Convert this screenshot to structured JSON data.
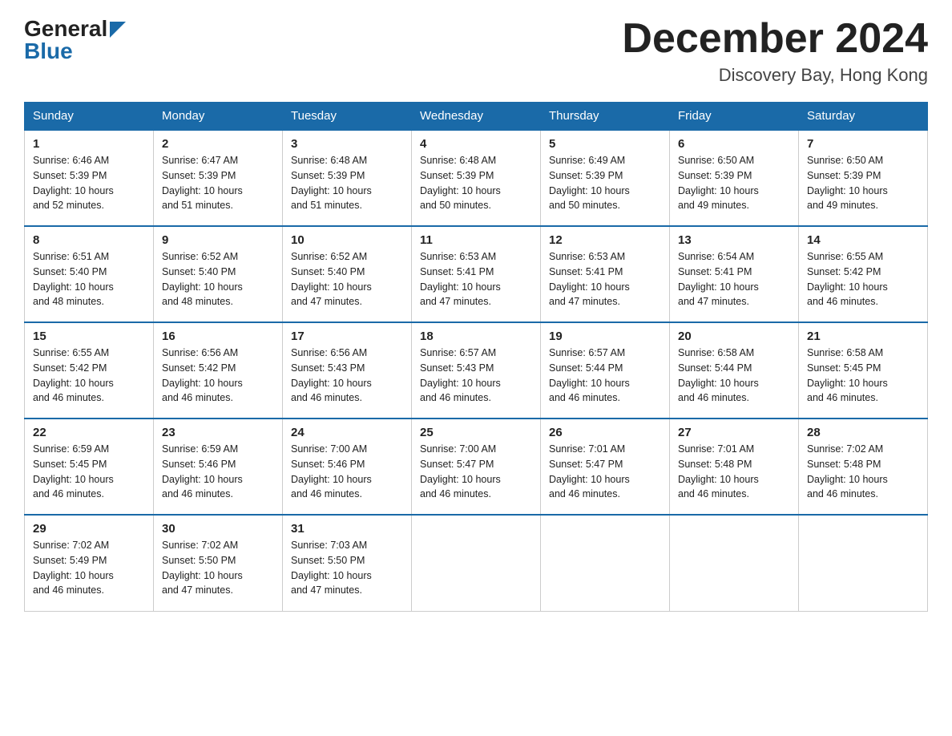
{
  "header": {
    "logo_general": "General",
    "logo_blue": "Blue",
    "title": "December 2024",
    "location": "Discovery Bay, Hong Kong"
  },
  "days_of_week": [
    "Sunday",
    "Monday",
    "Tuesday",
    "Wednesday",
    "Thursday",
    "Friday",
    "Saturday"
  ],
  "weeks": [
    [
      {
        "day": "1",
        "sunrise": "6:46 AM",
        "sunset": "5:39 PM",
        "daylight": "10 hours and 52 minutes."
      },
      {
        "day": "2",
        "sunrise": "6:47 AM",
        "sunset": "5:39 PM",
        "daylight": "10 hours and 51 minutes."
      },
      {
        "day": "3",
        "sunrise": "6:48 AM",
        "sunset": "5:39 PM",
        "daylight": "10 hours and 51 minutes."
      },
      {
        "day": "4",
        "sunrise": "6:48 AM",
        "sunset": "5:39 PM",
        "daylight": "10 hours and 50 minutes."
      },
      {
        "day": "5",
        "sunrise": "6:49 AM",
        "sunset": "5:39 PM",
        "daylight": "10 hours and 50 minutes."
      },
      {
        "day": "6",
        "sunrise": "6:50 AM",
        "sunset": "5:39 PM",
        "daylight": "10 hours and 49 minutes."
      },
      {
        "day": "7",
        "sunrise": "6:50 AM",
        "sunset": "5:39 PM",
        "daylight": "10 hours and 49 minutes."
      }
    ],
    [
      {
        "day": "8",
        "sunrise": "6:51 AM",
        "sunset": "5:40 PM",
        "daylight": "10 hours and 48 minutes."
      },
      {
        "day": "9",
        "sunrise": "6:52 AM",
        "sunset": "5:40 PM",
        "daylight": "10 hours and 48 minutes."
      },
      {
        "day": "10",
        "sunrise": "6:52 AM",
        "sunset": "5:40 PM",
        "daylight": "10 hours and 47 minutes."
      },
      {
        "day": "11",
        "sunrise": "6:53 AM",
        "sunset": "5:41 PM",
        "daylight": "10 hours and 47 minutes."
      },
      {
        "day": "12",
        "sunrise": "6:53 AM",
        "sunset": "5:41 PM",
        "daylight": "10 hours and 47 minutes."
      },
      {
        "day": "13",
        "sunrise": "6:54 AM",
        "sunset": "5:41 PM",
        "daylight": "10 hours and 47 minutes."
      },
      {
        "day": "14",
        "sunrise": "6:55 AM",
        "sunset": "5:42 PM",
        "daylight": "10 hours and 46 minutes."
      }
    ],
    [
      {
        "day": "15",
        "sunrise": "6:55 AM",
        "sunset": "5:42 PM",
        "daylight": "10 hours and 46 minutes."
      },
      {
        "day": "16",
        "sunrise": "6:56 AM",
        "sunset": "5:42 PM",
        "daylight": "10 hours and 46 minutes."
      },
      {
        "day": "17",
        "sunrise": "6:56 AM",
        "sunset": "5:43 PM",
        "daylight": "10 hours and 46 minutes."
      },
      {
        "day": "18",
        "sunrise": "6:57 AM",
        "sunset": "5:43 PM",
        "daylight": "10 hours and 46 minutes."
      },
      {
        "day": "19",
        "sunrise": "6:57 AM",
        "sunset": "5:44 PM",
        "daylight": "10 hours and 46 minutes."
      },
      {
        "day": "20",
        "sunrise": "6:58 AM",
        "sunset": "5:44 PM",
        "daylight": "10 hours and 46 minutes."
      },
      {
        "day": "21",
        "sunrise": "6:58 AM",
        "sunset": "5:45 PM",
        "daylight": "10 hours and 46 minutes."
      }
    ],
    [
      {
        "day": "22",
        "sunrise": "6:59 AM",
        "sunset": "5:45 PM",
        "daylight": "10 hours and 46 minutes."
      },
      {
        "day": "23",
        "sunrise": "6:59 AM",
        "sunset": "5:46 PM",
        "daylight": "10 hours and 46 minutes."
      },
      {
        "day": "24",
        "sunrise": "7:00 AM",
        "sunset": "5:46 PM",
        "daylight": "10 hours and 46 minutes."
      },
      {
        "day": "25",
        "sunrise": "7:00 AM",
        "sunset": "5:47 PM",
        "daylight": "10 hours and 46 minutes."
      },
      {
        "day": "26",
        "sunrise": "7:01 AM",
        "sunset": "5:47 PM",
        "daylight": "10 hours and 46 minutes."
      },
      {
        "day": "27",
        "sunrise": "7:01 AM",
        "sunset": "5:48 PM",
        "daylight": "10 hours and 46 minutes."
      },
      {
        "day": "28",
        "sunrise": "7:02 AM",
        "sunset": "5:48 PM",
        "daylight": "10 hours and 46 minutes."
      }
    ],
    [
      {
        "day": "29",
        "sunrise": "7:02 AM",
        "sunset": "5:49 PM",
        "daylight": "10 hours and 46 minutes."
      },
      {
        "day": "30",
        "sunrise": "7:02 AM",
        "sunset": "5:50 PM",
        "daylight": "10 hours and 47 minutes."
      },
      {
        "day": "31",
        "sunrise": "7:03 AM",
        "sunset": "5:50 PM",
        "daylight": "10 hours and 47 minutes."
      },
      null,
      null,
      null,
      null
    ]
  ]
}
